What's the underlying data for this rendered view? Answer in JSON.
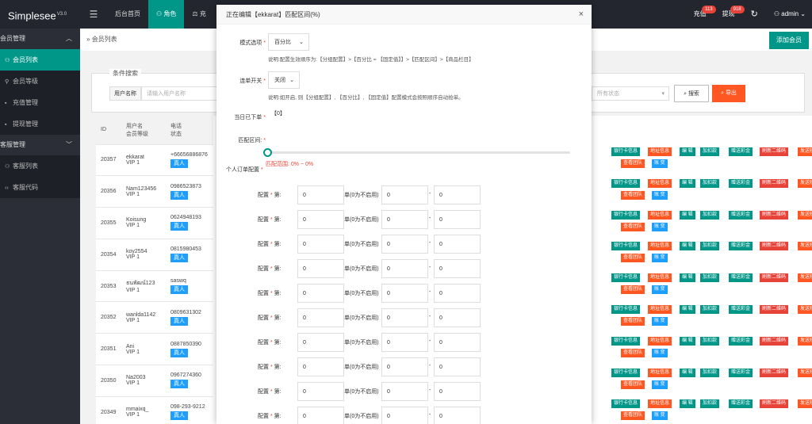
{
  "app": {
    "name": "Simplesee",
    "version": "V3.0"
  },
  "topbar": {
    "menu_icon": "menu-icon",
    "nav": [
      {
        "label": "后台首页"
      },
      {
        "label": "角色",
        "icon": "user-icon"
      },
      {
        "label": "充"
      }
    ],
    "recharge": {
      "label": "充值",
      "count": "113"
    },
    "withdraw": {
      "label": "提现",
      "count": "918"
    },
    "refresh_icon": "↻",
    "user": "admin"
  },
  "sidebar": {
    "groups": [
      {
        "label": "会员管理",
        "items": [
          {
            "label": "会员列表",
            "active": true
          },
          {
            "label": "会员等级"
          },
          {
            "label": "充值管理"
          },
          {
            "label": "提现管理"
          }
        ]
      },
      {
        "label": "客服管理",
        "items": [
          {
            "label": "客服列表"
          },
          {
            "label": "客服代码"
          }
        ]
      }
    ]
  },
  "breadcrumb": {
    "sep": "»",
    "label": "会员列表"
  },
  "add_member": "添加会员",
  "search": {
    "legend": "条件搜索",
    "username_label": "用户名称",
    "username_placeholder": "请输入用户名称",
    "status_placeholder": "所有状态",
    "search_btn": "搜索",
    "export_btn": "导出"
  },
  "table": {
    "headers": {
      "id": "ID",
      "user_top": "用户名",
      "user_bottom": "会员等级",
      "phone_top": "电话",
      "phone_bottom": "状态"
    },
    "rows": [
      {
        "id": "20357",
        "name": "ekkarat",
        "level": "VIP 1",
        "phone": "+66656886876",
        "status": "真人"
      },
      {
        "id": "20356",
        "name": "Nam123456",
        "level": "VIP 1",
        "phone": "0986523873",
        "status": "真人"
      },
      {
        "id": "20355",
        "name": "Koisung",
        "level": "VIP 1",
        "phone": "0624948193",
        "status": "真人"
      },
      {
        "id": "20354",
        "name": "koy2554",
        "level": "VIP 1",
        "phone": "0815980453",
        "status": "真人"
      },
      {
        "id": "20353",
        "name": "ธนพัฒน์123",
        "level": "VIP 1",
        "phone": "saswq",
        "status": "真人"
      },
      {
        "id": "20352",
        "name": "wanlda1142",
        "level": "VIP 1",
        "phone": "0809631302",
        "status": "真人"
      },
      {
        "id": "20351",
        "name": "Ani",
        "level": "VIP 1",
        "phone": "0887850390",
        "status": "真人"
      },
      {
        "id": "20350",
        "name": "Na2003",
        "level": "VIP 1",
        "phone": "0967274360",
        "status": "真人"
      },
      {
        "id": "20349",
        "name": "mmaixq_",
        "level": "VIP 1",
        "phone": "098-293-9212",
        "status": "真人"
      }
    ],
    "ops": {
      "bank": "银行卡信息",
      "addr": "地址信息",
      "edit": "编 辑",
      "add_money": "加扣款",
      "gift": "赠送彩金",
      "qrcode": "刷新二维码",
      "sms": "发送短信",
      "team": "查看团队",
      "account": "账 变"
    }
  },
  "modal": {
    "title": "正在编辑【ekkarat】匹配区间(%)",
    "close": "×",
    "mode_label": "模式选项",
    "mode_value": "百分比",
    "mode_tip": "说明:配置生效顺序为:【分组配置】>【百分比 = 【固定值】】>【匹配区间】>【商品栏目】",
    "grab_label": "连单开关",
    "grab_value": "关闭",
    "grab_tip": "说明:如开启, 则【分组配置】, 【百分比】, 【固定值】配置模式会按照顺序自动抢单。",
    "today_label": "当日已下单",
    "today_value": "【0】",
    "range_label": "匹配区间:",
    "range_text": "匹配范围: 0% ~ 0%",
    "personal_label": "个人订单配置",
    "cfg_label": "配置",
    "cfg_seq": "第:",
    "cfg_mid": "单(0为不启用)",
    "cfg_dash": "-",
    "cfg_rows": [
      [
        "0",
        "0",
        "0"
      ],
      [
        "0",
        "0",
        "0"
      ],
      [
        "0",
        "0",
        "0"
      ],
      [
        "0",
        "0",
        "0"
      ],
      [
        "0",
        "0",
        "0"
      ],
      [
        "0",
        "0",
        "0"
      ],
      [
        "0",
        "0",
        "0"
      ],
      [
        "0",
        "0",
        "0"
      ],
      [
        "0",
        "0",
        "0"
      ],
      [
        "0",
        "0",
        "0"
      ]
    ]
  },
  "colors": {
    "topbar": "#23262e",
    "sidebar": "#2b2e37",
    "accent": "#009688",
    "orange": "#ff5722",
    "red": "#e84339",
    "blue": "#1e9fff"
  }
}
